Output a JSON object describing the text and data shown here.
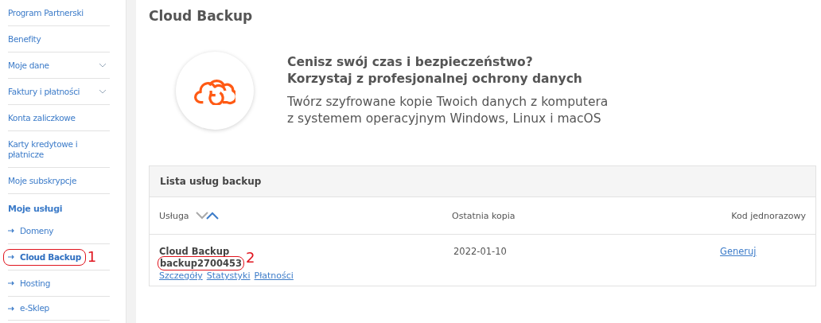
{
  "sidebar": {
    "items": [
      {
        "label": "Program Partnerski",
        "kind": "link",
        "selected": false
      },
      {
        "label": "Benefity",
        "kind": "link",
        "selected": false
      },
      {
        "label": "Moje dane",
        "kind": "dropdown",
        "selected": false
      },
      {
        "label": "Faktury i płatności",
        "kind": "dropdown",
        "selected": false
      },
      {
        "label": "Konta zaliczkowe",
        "kind": "link",
        "selected": false
      },
      {
        "label": "Karty kredytowe i płatnicze",
        "kind": "link",
        "selected": false
      },
      {
        "label": "Moje subskrypcje",
        "kind": "link",
        "selected": false
      },
      {
        "label": "Moje usługi",
        "kind": "heading"
      },
      {
        "label": "Domeny",
        "kind": "sublink",
        "selected": false
      },
      {
        "label": "Cloud Backup",
        "kind": "sublink",
        "selected": true,
        "annotation": "1"
      },
      {
        "label": "Hosting",
        "kind": "sublink",
        "selected": false
      },
      {
        "label": "e-Sklep",
        "kind": "sublink",
        "selected": false
      }
    ]
  },
  "page": {
    "title": "Cloud Backup"
  },
  "promo": {
    "headline": [
      "Cenisz swój czas i bezpieczeństwo?",
      "Korzystaj z profesjonalnej ochrony danych"
    ],
    "text": [
      "Twórz szyfrowane kopie Twoich danych z komputera",
      "z systemem operacyjnym Windows, Linux i macOS"
    ]
  },
  "table": {
    "title": "Lista usług backup",
    "columns": [
      {
        "label": "Usługa",
        "sort_ascending": true
      },
      {
        "label": "Ostatnia kopia"
      },
      {
        "label": "Kod jednorazowy"
      }
    ],
    "rows": [
      {
        "service": "Cloud Backup",
        "id": "backup2700453",
        "id_annotation": "2",
        "links": [
          "Szczegóły",
          "Statystyki",
          "Płatności"
        ],
        "last_copy": "2022-01-10",
        "code_link": "Generuj"
      }
    ]
  }
}
